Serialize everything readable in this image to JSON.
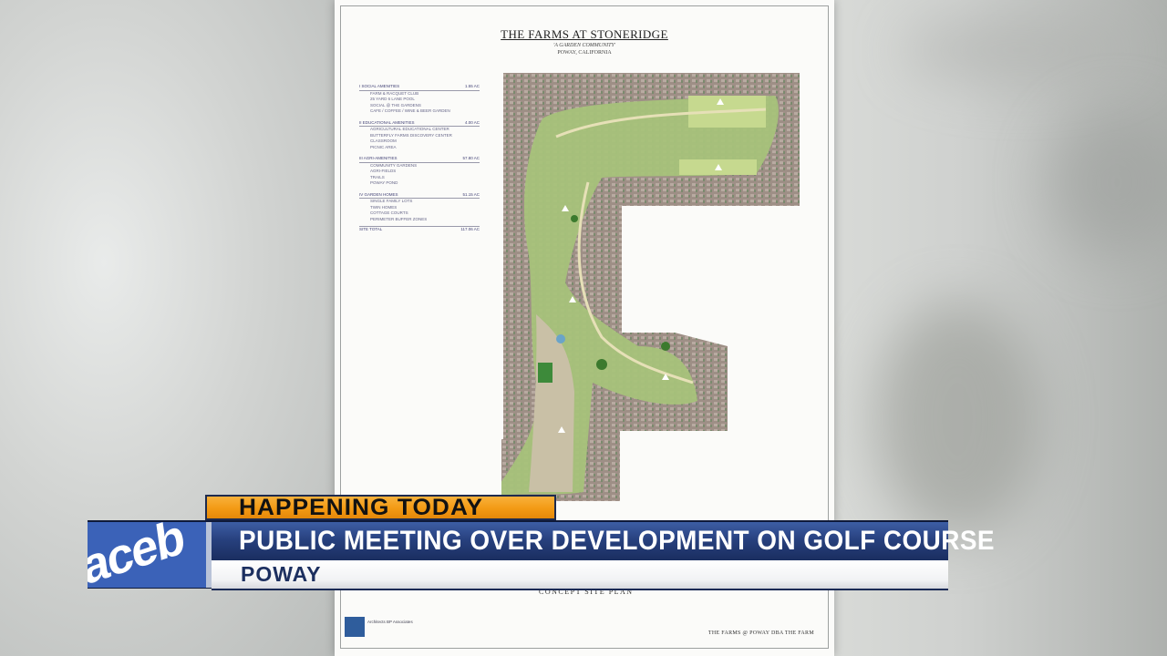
{
  "document": {
    "title": "THE FARMS AT STONERIDGE",
    "subtitle": "'A GARDEN COMMUNITY'",
    "location": "POWAY, CALIFORNIA",
    "legend": [
      {
        "head": "I   SOCIAL AMENITIES",
        "value": "1.55 AC",
        "items": [
          "FARM & RACQUET CLUB",
          "25 YARD 6 LANE POOL",
          "SOCIAL @ THE GARDENS",
          "CAFE / COFFEE / WINE & BEER GARDEN"
        ]
      },
      {
        "head": "II   EDUCATIONAL AMENITIES",
        "value": "4.00 AC",
        "items": [
          "AGRICULTURAL EDUCATIONAL CENTER",
          "BUTTERFLY FARMS DISCOVERY CENTER",
          "CLASSROOM",
          "PICNIC AREA"
        ]
      },
      {
        "head": "III   AGRI-AMENITIES",
        "value": "57.80 AC",
        "items": [
          "COMMUNITY GARDENS",
          "AGRI-FIELDS",
          "TRAILS",
          "POWAY POND"
        ]
      },
      {
        "head": "IV   GARDEN HOMES",
        "value": "51.15 AC",
        "items": [
          "SINGLE FAMILY LOTS",
          "TWIN HOMES",
          "COTTAGE COURTS",
          "PERIMETER BUFFER ZONES"
        ]
      }
    ],
    "site_total_label": "SITE TOTAL",
    "site_total_value": "117.06 AC",
    "concept_label": "CONCEPT SITE PLAN",
    "architect": "Architects BP Associates",
    "footer": "THE FARMS @ POWAY DBA THE FARM"
  },
  "lower_third": {
    "kicker": "HAPPENING TODAY",
    "headline": "PUBLIC MEETING OVER DEVELOPMENT ON GOLF COURSE",
    "location": "POWAY",
    "logo_text": "aceb"
  },
  "colors": {
    "kicker_bg": "#f39a14",
    "headline_bg": "#27407d",
    "location_text": "#1c2f5f"
  }
}
